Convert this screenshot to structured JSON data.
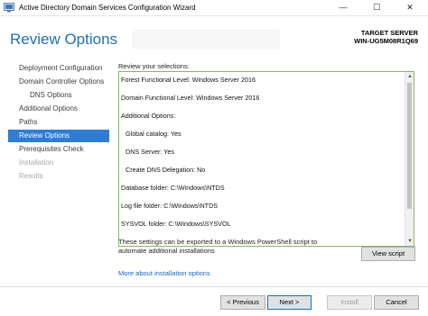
{
  "window": {
    "title": "Active Directory Domain Services Configuration Wizard",
    "controls": {
      "minimize": "—",
      "maximize": "☐",
      "close": "✕"
    }
  },
  "header": {
    "page_title": "Review Options",
    "target_server_label": "TARGET SERVER",
    "target_server_name": "WIN-UG5M08R1Q69"
  },
  "nav": {
    "items": [
      {
        "label": "Deployment Configuration",
        "state": "normal"
      },
      {
        "label": "Domain Controller Options",
        "state": "normal"
      },
      {
        "label": "DNS Options",
        "state": "normal"
      },
      {
        "label": "Additional Options",
        "state": "normal"
      },
      {
        "label": "Paths",
        "state": "normal"
      },
      {
        "label": "Review Options",
        "state": "active"
      },
      {
        "label": "Prerequisites Check",
        "state": "normal"
      },
      {
        "label": "Installation",
        "state": "disabled"
      },
      {
        "label": "Results",
        "state": "disabled"
      }
    ]
  },
  "main": {
    "review_label": "Review your selections:",
    "review_lines": [
      "Forest Functional Level: Windows Server 2016",
      "Domain Functional Level: Windows Server 2016",
      "Additional Options:",
      "Global catalog: Yes",
      "DNS Server: Yes",
      "Create DNS Delegation: No",
      "Database folder: C:\\Windows\\NTDS",
      "Log file folder: C:\\Windows\\NTDS",
      "SYSVOL folder: C:\\Windows\\SYSVOL"
    ],
    "export_text": "These settings can be exported to a Windows PowerShell script to automate additional installations",
    "view_script_label": "View script",
    "more_link": "More about installation options"
  },
  "footer": {
    "previous_label": "< Previous",
    "next_label": "Next >",
    "install_label": "Install",
    "cancel_label": "Cancel"
  },
  "colors": {
    "accent": "#2f7cd2",
    "title_blue": "#1f6fb3",
    "link": "#1565b8",
    "review_border": "#8bb36b"
  }
}
